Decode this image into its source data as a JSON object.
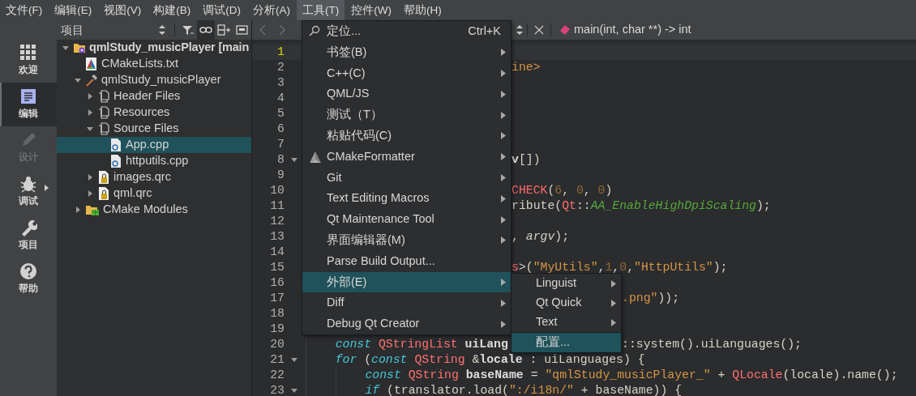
{
  "menu_bar": [
    {
      "label": "文件(F)",
      "selected": false
    },
    {
      "label": "编辑(E)",
      "selected": false
    },
    {
      "label": "视图(V)",
      "selected": false
    },
    {
      "label": "构建(B)",
      "selected": false
    },
    {
      "label": "调试(D)",
      "selected": false
    },
    {
      "label": "分析(A)",
      "selected": false
    },
    {
      "label": "工具(T)",
      "selected": true
    },
    {
      "label": "控件(W)",
      "selected": false
    },
    {
      "label": "帮助(H)",
      "selected": false
    }
  ],
  "mode_bar": [
    {
      "kind": "welcome",
      "label": "欢迎",
      "selected": false,
      "disabled": false,
      "has_menu": false
    },
    {
      "kind": "edit",
      "label": "编辑",
      "selected": true,
      "disabled": false,
      "has_menu": false
    },
    {
      "kind": "design",
      "label": "设计",
      "selected": false,
      "disabled": true,
      "has_menu": false
    },
    {
      "kind": "debug",
      "label": "调试",
      "selected": false,
      "disabled": false,
      "has_menu": true
    },
    {
      "kind": "projects",
      "label": "项目",
      "selected": false,
      "disabled": false,
      "has_menu": false
    },
    {
      "kind": "help",
      "label": "帮助",
      "selected": false,
      "disabled": false,
      "has_menu": false
    }
  ],
  "project_panel": {
    "title": "项目",
    "tree": [
      {
        "label": "qmlStudy_musicPlayer [main",
        "kind": "project",
        "expanded": true,
        "selected": false,
        "children": [
          {
            "label": "CMakeLists.txt",
            "kind": "cmakefile",
            "selected": false
          },
          {
            "label": "qmlStudy_musicPlayer",
            "kind": "target",
            "expanded": true,
            "selected": false,
            "children": [
              {
                "label": "Header Files",
                "kind": "group",
                "expanded": false,
                "selected": false
              },
              {
                "label": "Resources",
                "kind": "group",
                "expanded": false,
                "selected": false
              },
              {
                "label": "Source Files",
                "kind": "group",
                "expanded": true,
                "selected": false,
                "children": [
                  {
                    "label": "App.cpp",
                    "kind": "source",
                    "selected": true
                  },
                  {
                    "label": "httputils.cpp",
                    "kind": "source",
                    "selected": false
                  }
                ]
              },
              {
                "label": "images.qrc",
                "kind": "resource",
                "expanded": false,
                "selected": false
              },
              {
                "label": "qml.qrc",
                "kind": "resource",
                "expanded": false,
                "selected": false
              }
            ]
          },
          {
            "label": "CMake Modules",
            "kind": "modules",
            "expanded": false,
            "selected": false
          }
        ]
      }
    ]
  },
  "editor": {
    "symbol": "main(int, char **) -> int",
    "lines": [
      {
        "number": "1",
        "kind": "covered",
        "current": true,
        "foldable": false
      },
      {
        "number": "2",
        "kind": "tail",
        "current": false,
        "foldable": false,
        "fragments": [
          [
            {
              "text": "ine>",
              "kind": "string"
            }
          ]
        ]
      },
      {
        "number": "3",
        "kind": "covered",
        "current": false,
        "foldable": false
      },
      {
        "number": "4",
        "kind": "covered",
        "current": false,
        "foldable": false
      },
      {
        "number": "5",
        "kind": "covered",
        "current": false,
        "foldable": false
      },
      {
        "number": "6",
        "kind": "covered",
        "current": false,
        "foldable": false
      },
      {
        "number": "7",
        "kind": "covered",
        "current": false,
        "foldable": false
      },
      {
        "number": "8",
        "kind": "tail",
        "current": false,
        "foldable": true,
        "fragments": [
          [
            {
              "text": "v",
              "kind": "bold"
            },
            {
              "text": "[])",
              "kind": "plain"
            }
          ]
        ]
      },
      {
        "number": "9",
        "kind": "covered",
        "current": false,
        "foldable": false
      },
      {
        "number": "10",
        "kind": "tail",
        "current": false,
        "foldable": false,
        "fragments": [
          [
            {
              "text": "CHECK",
              "kind": "macro"
            },
            {
              "text": "(",
              "kind": "plain"
            },
            {
              "text": "6",
              "kind": "number"
            },
            {
              "text": ", ",
              "kind": "plain"
            },
            {
              "text": "0",
              "kind": "number"
            },
            {
              "text": ", ",
              "kind": "plain"
            },
            {
              "text": "0",
              "kind": "number"
            },
            {
              "text": ")",
              "kind": "plain"
            }
          ]
        ]
      },
      {
        "number": "11",
        "kind": "tail",
        "current": false,
        "foldable": false,
        "fragments": [
          [
            {
              "text": "ribute(",
              "kind": "plain"
            },
            {
              "text": "Qt",
              "kind": "type"
            },
            {
              "text": "::",
              "kind": "plain"
            },
            {
              "text": "AA_EnableHighDpiScaling",
              "kind": "enum"
            },
            {
              "text": ");",
              "kind": "plain"
            }
          ]
        ]
      },
      {
        "number": "12",
        "kind": "covered",
        "current": false,
        "foldable": false
      },
      {
        "number": "13",
        "kind": "tail",
        "current": false,
        "foldable": false,
        "fragments": [
          [
            {
              "text": ", ",
              "kind": "plain"
            },
            {
              "text": "argv",
              "kind": "param"
            },
            {
              "text": ");",
              "kind": "plain"
            }
          ]
        ]
      },
      {
        "number": "14",
        "kind": "covered",
        "current": false,
        "foldable": false
      },
      {
        "number": "15",
        "kind": "tail",
        "current": false,
        "foldable": false,
        "fragments": [
          [
            {
              "text": "s",
              "kind": "type"
            },
            {
              "text": ">(",
              "kind": "plain"
            },
            {
              "text": "\"MyUtils\"",
              "kind": "string"
            },
            {
              "text": ",",
              "kind": "plain"
            },
            {
              "text": "1",
              "kind": "number"
            },
            {
              "text": ",",
              "kind": "plain"
            },
            {
              "text": "0",
              "kind": "number"
            },
            {
              "text": ",",
              "kind": "plain"
            },
            {
              "text": "\"HttpUtils\"",
              "kind": "string"
            },
            {
              "text": ");",
              "kind": "plain"
            }
          ]
        ]
      },
      {
        "number": "16",
        "kind": "covered",
        "current": false,
        "foldable": false
      },
      {
        "number": "17",
        "kind": "tail_sub",
        "current": false,
        "foldable": false,
        "fragments": [
          [
            {
              "text": ".png\"",
              "kind": "string"
            },
            {
              "text": "));",
              "kind": "plain"
            }
          ]
        ]
      },
      {
        "number": "18",
        "kind": "covered",
        "current": false,
        "foldable": false
      },
      {
        "number": "19",
        "kind": "covered",
        "current": false,
        "foldable": false
      },
      {
        "number": "20",
        "kind": "split",
        "current": false,
        "foldable": false,
        "fragments": [
          [
            {
              "text": "const",
              "kind": "keyword"
            },
            {
              "text": " QStringList",
              "kind": "type"
            },
            {
              "text": " uiLang",
              "kind": "bold"
            }
          ],
          [
            {
              "text": "::system().uiLanguages();",
              "kind": "plain"
            }
          ]
        ]
      },
      {
        "number": "21",
        "kind": "body",
        "current": false,
        "foldable": true,
        "fragments": [
          [
            {
              "text": "for",
              "kind": "keyword"
            },
            {
              "text": " (",
              "kind": "plain"
            },
            {
              "text": "const",
              "kind": "keyword"
            },
            {
              "text": " QString",
              "kind": "type"
            },
            {
              "text": " &",
              "kind": "plain"
            },
            {
              "text": "locale",
              "kind": "bold"
            },
            {
              "text": " : uiLanguages) {",
              "kind": "plain"
            }
          ]
        ]
      },
      {
        "number": "22",
        "kind": "nested",
        "current": false,
        "foldable": false,
        "fragments": [
          [
            {
              "text": "const",
              "kind": "keyword"
            },
            {
              "text": " QString",
              "kind": "type"
            },
            {
              "text": " baseName",
              "kind": "bold"
            },
            {
              "text": " = ",
              "kind": "plain"
            },
            {
              "text": "\"qmlStudy_musicPlayer_\"",
              "kind": "string"
            },
            {
              "text": " + ",
              "kind": "plain"
            },
            {
              "text": "QLocale",
              "kind": "type"
            },
            {
              "text": "(locale).name();",
              "kind": "plain"
            }
          ]
        ]
      },
      {
        "number": "23",
        "kind": "nested",
        "current": false,
        "foldable": true,
        "fragments": [
          [
            {
              "text": "if",
              "kind": "keyword"
            },
            {
              "text": " (translator.load(",
              "kind": "plain"
            },
            {
              "text": "\":/i18n/\"",
              "kind": "string"
            },
            {
              "text": " + baseName)) {",
              "kind": "plain"
            }
          ]
        ]
      }
    ]
  },
  "tools_menu": {
    "items": [
      {
        "label": "定位...",
        "kind": "locator",
        "shortcut": "Ctrl+K",
        "submenu": false,
        "selected": false
      },
      {
        "label": "书签(B)",
        "kind": "plain",
        "submenu": true,
        "selected": false
      },
      {
        "label": "C++(C)",
        "kind": "plain",
        "submenu": true,
        "selected": false
      },
      {
        "label": "QML/JS",
        "kind": "plain",
        "submenu": true,
        "selected": false
      },
      {
        "label": "测试（T）",
        "kind": "plain",
        "submenu": true,
        "selected": false
      },
      {
        "label": "粘贴代码(C)",
        "kind": "plain",
        "submenu": true,
        "selected": false
      },
      {
        "label": "CMakeFormatter",
        "kind": "formatter",
        "submenu": true,
        "selected": false
      },
      {
        "label": "Git",
        "kind": "plain",
        "submenu": true,
        "selected": false
      },
      {
        "label": "Text Editing Macros",
        "kind": "plain",
        "submenu": true,
        "selected": false
      },
      {
        "label": "Qt Maintenance Tool",
        "kind": "plain",
        "submenu": true,
        "selected": false
      },
      {
        "label": "界面编辑器(M)",
        "kind": "plain",
        "submenu": true,
        "selected": false
      },
      {
        "label": "Parse Build Output...",
        "kind": "plain",
        "submenu": false,
        "selected": false
      },
      {
        "label": "外部(E)",
        "kind": "plain",
        "submenu": true,
        "selected": true
      },
      {
        "label": "Diff",
        "kind": "plain",
        "submenu": true,
        "selected": false
      },
      {
        "label": "Debug Qt Creator",
        "kind": "plain",
        "submenu": true,
        "selected": false
      }
    ]
  },
  "external_submenu": {
    "items": [
      {
        "kind": "item",
        "label": "Linguist",
        "submenu": true,
        "selected": false
      },
      {
        "kind": "item",
        "label": "Qt Quick",
        "submenu": true,
        "selected": false
      },
      {
        "kind": "item",
        "label": "Text",
        "submenu": true,
        "selected": false
      },
      {
        "kind": "separator"
      },
      {
        "kind": "item",
        "label": "配置...",
        "submenu": false,
        "selected": true
      }
    ]
  }
}
